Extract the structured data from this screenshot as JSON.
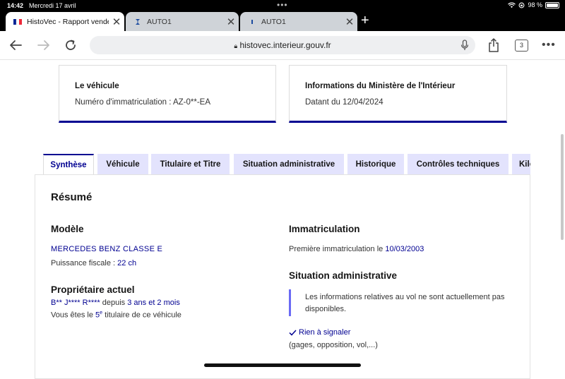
{
  "status": {
    "time": "14:42",
    "date": "Mercredi 17 avril",
    "battery": "98 %"
  },
  "browser_tabs": [
    {
      "title": "HistoVec - Rapport vendeur",
      "icon": "french-flag-icon",
      "active": true
    },
    {
      "title": "AUTO1",
      "icon": "auto1-logo-icon",
      "active": false
    },
    {
      "title": "AUTO1",
      "icon": "auto1-logo-icon",
      "active": false
    }
  ],
  "toolbar": {
    "url": "histovec.interieur.gouv.fr",
    "tab_count": "3"
  },
  "cards": [
    {
      "title": "Le véhicule",
      "subtitle": "Numéro d'immatriculation : AZ-0**-EA"
    },
    {
      "title": "Informations du Ministère de l'Intérieur",
      "subtitle": "Datant du 12/04/2024"
    }
  ],
  "page_tabs": [
    {
      "label": "Synthèse",
      "active": true
    },
    {
      "label": "Véhicule",
      "active": false
    },
    {
      "label": "Titulaire et Titre",
      "active": false
    },
    {
      "label": "Situation administrative",
      "active": false
    },
    {
      "label": "Historique",
      "active": false
    },
    {
      "label": "Contrôles techniques",
      "active": false
    },
    {
      "label": "Kilométrage",
      "active": false
    }
  ],
  "summary": {
    "heading": "Résumé",
    "modele": {
      "heading": "Modèle",
      "name": "MERCEDES BENZ CLASSE E",
      "puissance_label": "Puissance fiscale : ",
      "puissance_value": "22 ch"
    },
    "proprietaire": {
      "heading": "Propriétaire actuel",
      "name": "B** J**** R****",
      "depuis": " depuis ",
      "duration": "3 ans et 2 mois",
      "rank_prefix": "Vous êtes le ",
      "rank_number": "5",
      "rank_sup": "e",
      "rank_suffix": " titulaire de ce véhicule"
    },
    "immatriculation": {
      "heading": "Immatriculation",
      "label": "Première immatriculation le ",
      "date": "10/03/2003"
    },
    "situation": {
      "heading": "Situation administrative",
      "notice": "Les informations relatives au vol ne sont actuellement pas disponibles.",
      "ok_label": "Rien à signaler",
      "ok_detail": "(gages, opposition, vol,...)"
    }
  },
  "colors": {
    "accent": "#000091",
    "tab_bg": "#e3e3fd",
    "notice_border": "#6a6af4"
  }
}
